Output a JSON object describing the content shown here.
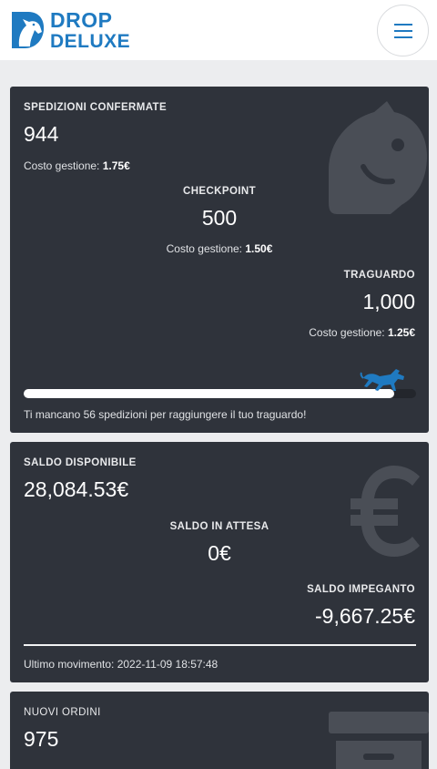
{
  "brand": {
    "line1": "DROP",
    "line2": "DELUXE",
    "color": "#1f7ac1"
  },
  "header": {
    "menu_icon": "hamburger-icon"
  },
  "shipments": {
    "confirmed": {
      "label": "SPEDIZIONI CONFERMATE",
      "value": "944",
      "fee_label": "Costo gestione:",
      "fee_value": "1.75€"
    },
    "checkpoint": {
      "label": "CHECKPOINT",
      "value": "500",
      "fee_label": "Costo gestione:",
      "fee_value": "1.50€"
    },
    "goal": {
      "label": "TRAGUARDO",
      "value": "1,000",
      "fee_label": "Costo gestione:",
      "fee_value": "1.25€"
    },
    "progress_fraction": 0.944,
    "progress_message": "Ti mancano 56 spedizioni per raggiungere il tuo traguardo!",
    "background_icon": "chess-knight-icon",
    "marker_icon": "horse-icon"
  },
  "balance": {
    "available": {
      "label": "SALDO DISPONIBILE",
      "value": "28,084.53€"
    },
    "pending": {
      "label": "SALDO IN ATTESA",
      "value": "0€"
    },
    "committed": {
      "label": "SALDO IMPEGANTO",
      "value": "-9,667.25€"
    },
    "last_movement": "Ultimo movimento: 2022-11-09 18:57:48",
    "background_icon": "euro-icon"
  },
  "orders": {
    "label": "NUOVI ORDINI",
    "value": "975",
    "background_icon": "archive-box-icon"
  }
}
